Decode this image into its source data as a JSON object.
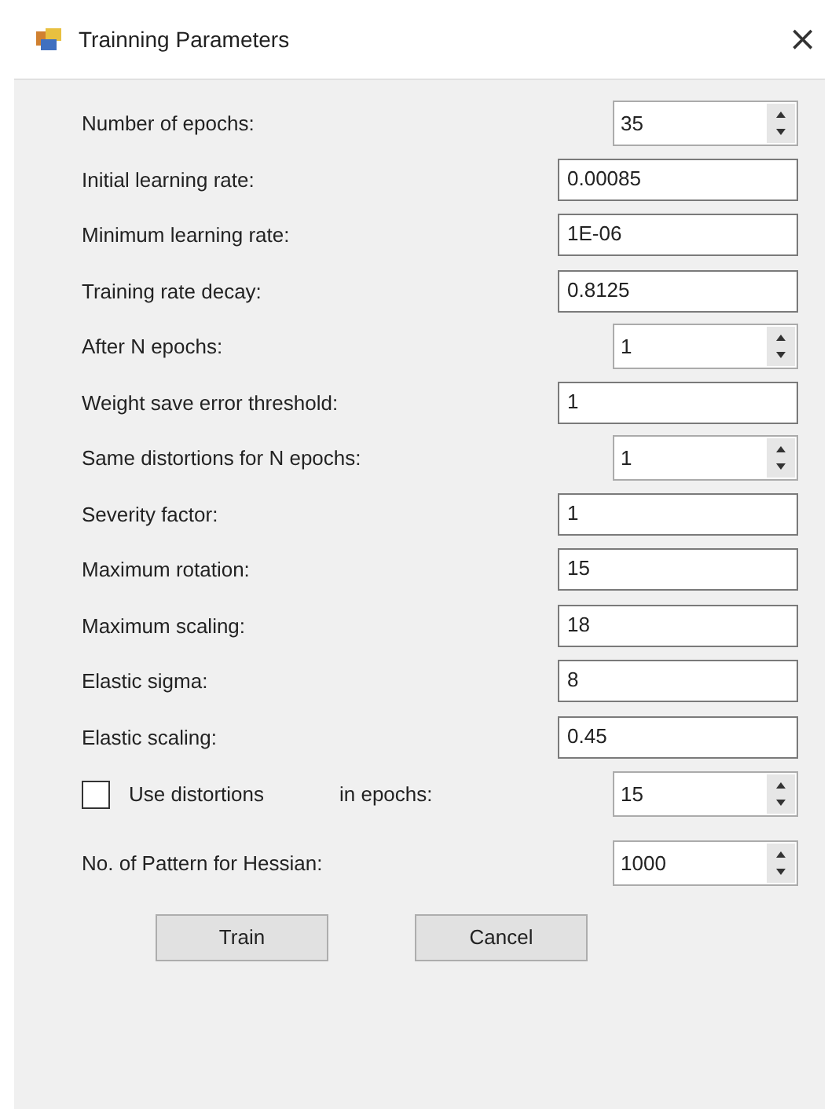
{
  "window": {
    "title": "Trainning Parameters",
    "close": "×"
  },
  "fields": [
    {
      "kind": "spin",
      "label": "Number of epochs:",
      "value": "35"
    },
    {
      "kind": "text",
      "label": "Initial learning rate:",
      "value": "0.00085"
    },
    {
      "kind": "text",
      "label": "Minimum learning rate:",
      "value": "1E-06"
    },
    {
      "kind": "text",
      "label": "Training rate decay:",
      "value": "0.8125"
    },
    {
      "kind": "spin",
      "label": "After N epochs:",
      "value": "1"
    },
    {
      "kind": "text",
      "label": "Weight save error threshold:",
      "value": "1"
    },
    {
      "kind": "spin",
      "label": "Same distortions for N epochs:",
      "value": "1"
    },
    {
      "kind": "text",
      "label": "Severity factor:",
      "value": "1"
    },
    {
      "kind": "text",
      "label": "Maximum rotation:",
      "value": "15"
    },
    {
      "kind": "text",
      "label": "Maximum scaling:",
      "value": "18"
    },
    {
      "kind": "text",
      "label": "Elastic sigma:",
      "value": "8"
    },
    {
      "kind": "text",
      "label": "Elastic scaling:",
      "value": "0.45"
    },
    {
      "kind": "checkspin",
      "label": "Use distortions",
      "checked": false,
      "suffix": "in epochs:",
      "value": "15"
    },
    {
      "kind": "spin",
      "label": "No. of Pattern for Hessian:",
      "value": "1000"
    }
  ],
  "buttons": [
    "Train",
    "Cancel"
  ]
}
